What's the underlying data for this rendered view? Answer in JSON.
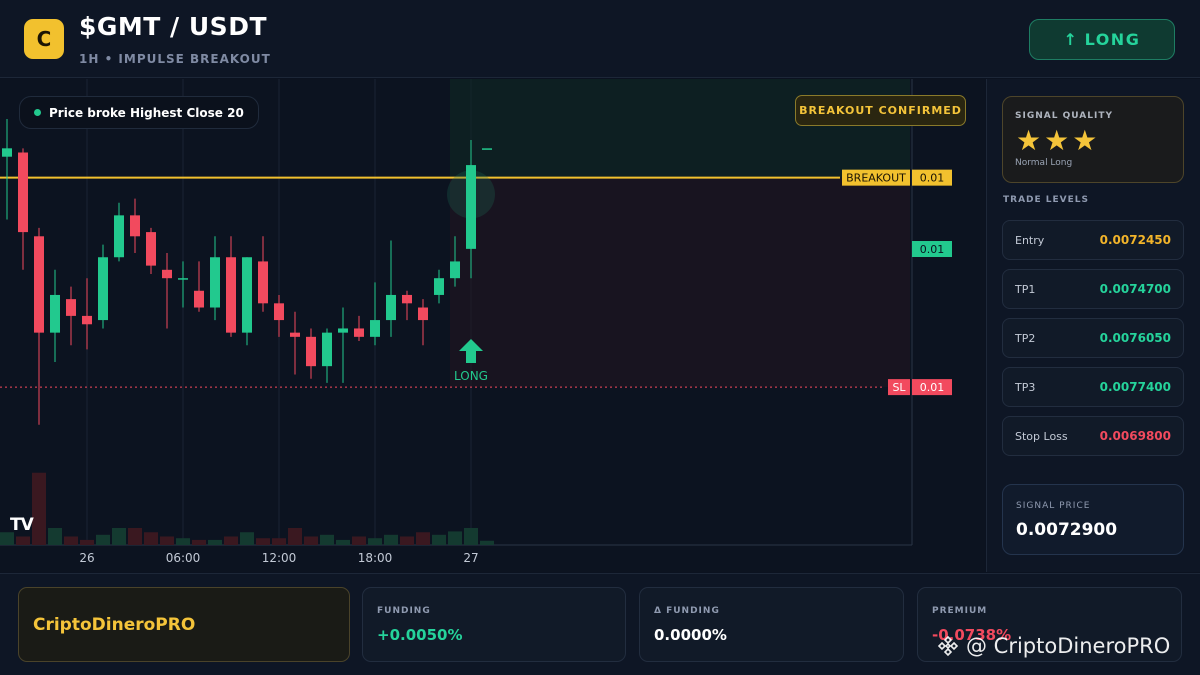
{
  "header": {
    "logo_letter": "C",
    "pair": "$GMT / USDT",
    "subtitle": "1H • IMPULSE BREAKOUT",
    "signal_label": "LONG"
  },
  "chart": {
    "status_pill": "Price broke Highest Close 20",
    "confirmed_badge": "BREAKOUT CONFIRMED",
    "long_marker": "LONG",
    "breakout_tag": "BREAKOUT",
    "sl_tag": "SL",
    "price_tags": [
      "0.01",
      "0.01",
      "0.01"
    ],
    "x_ticks": [
      "26",
      "06:00",
      "12:00",
      "18:00",
      "27"
    ],
    "tv_logo": "TV"
  },
  "panel": {
    "quality_label": "SIGNAL QUALITY",
    "quality_stars": "★★★",
    "quality_type": "Normal Long",
    "levels_title": "TRADE LEVELS",
    "levels": [
      {
        "name": "Entry",
        "value": "0.0072450",
        "color": "#f2b42a"
      },
      {
        "name": "TP1",
        "value": "0.0074700",
        "color": "#25d39b"
      },
      {
        "name": "TP2",
        "value": "0.0076050",
        "color": "#25d39b"
      },
      {
        "name": "TP3",
        "value": "0.0077400",
        "color": "#25d39b"
      },
      {
        "name": "Stop Loss",
        "value": "0.0069800",
        "color": "#f24a5e"
      }
    ],
    "signal_price_label": "SIGNAL PRICE",
    "signal_price": "0.0072900"
  },
  "footer": {
    "brand": "CriptoDineroPRO",
    "funding_label": "FUNDING",
    "funding_value": "+0.0050%",
    "dfunding_label": "Δ FUNDING",
    "dfunding_value": "0.0000%",
    "premium_label": "PREMIUM",
    "premium_value": "-0.0738%",
    "watermark": "@ CriptoDineroPRO"
  },
  "colors": {
    "up": "#22c98e",
    "down": "#f24a5e",
    "breakout": "#f2c12e"
  },
  "chart_data": {
    "type": "candlestick",
    "candles": [
      {
        "o": 0.007255,
        "h": 0.0073,
        "l": 0.00718,
        "c": 0.007265
      },
      {
        "o": 0.00726,
        "h": 0.007265,
        "l": 0.00712,
        "c": 0.007165
      },
      {
        "o": 0.00716,
        "h": 0.00717,
        "l": 0.006935,
        "c": 0.007045
      },
      {
        "o": 0.007045,
        "h": 0.00712,
        "l": 0.00701,
        "c": 0.00709
      },
      {
        "o": 0.007085,
        "h": 0.0071,
        "l": 0.00703,
        "c": 0.007065
      },
      {
        "o": 0.007065,
        "h": 0.00711,
        "l": 0.007025,
        "c": 0.007055
      },
      {
        "o": 0.00706,
        "h": 0.00715,
        "l": 0.00705,
        "c": 0.007135
      },
      {
        "o": 0.007135,
        "h": 0.0072,
        "l": 0.00713,
        "c": 0.007185
      },
      {
        "o": 0.007185,
        "h": 0.007205,
        "l": 0.00714,
        "c": 0.00716
      },
      {
        "o": 0.007165,
        "h": 0.00717,
        "l": 0.007115,
        "c": 0.007125
      },
      {
        "o": 0.00712,
        "h": 0.00714,
        "l": 0.00705,
        "c": 0.00711
      },
      {
        "o": 0.00711,
        "h": 0.00713,
        "l": 0.007075,
        "c": 0.00711
      },
      {
        "o": 0.007095,
        "h": 0.00713,
        "l": 0.00707,
        "c": 0.007075
      },
      {
        "o": 0.007075,
        "h": 0.00716,
        "l": 0.00706,
        "c": 0.007135
      },
      {
        "o": 0.007135,
        "h": 0.00716,
        "l": 0.00704,
        "c": 0.007045
      },
      {
        "o": 0.007045,
        "h": 0.007135,
        "l": 0.00703,
        "c": 0.007135
      },
      {
        "o": 0.00713,
        "h": 0.00716,
        "l": 0.00707,
        "c": 0.00708
      },
      {
        "o": 0.00708,
        "h": 0.00709,
        "l": 0.00704,
        "c": 0.00706
      },
      {
        "o": 0.007045,
        "h": 0.00707,
        "l": 0.006995,
        "c": 0.00704
      },
      {
        "o": 0.00704,
        "h": 0.00705,
        "l": 0.00699,
        "c": 0.007005
      },
      {
        "o": 0.007005,
        "h": 0.00705,
        "l": 0.006985,
        "c": 0.007045
      },
      {
        "o": 0.007045,
        "h": 0.007075,
        "l": 0.006985,
        "c": 0.00705
      },
      {
        "o": 0.00705,
        "h": 0.007065,
        "l": 0.007035,
        "c": 0.00704
      },
      {
        "o": 0.00704,
        "h": 0.007105,
        "l": 0.00703,
        "c": 0.00706
      },
      {
        "o": 0.00706,
        "h": 0.007155,
        "l": 0.00704,
        "c": 0.00709
      },
      {
        "o": 0.00709,
        "h": 0.007095,
        "l": 0.00706,
        "c": 0.00708
      },
      {
        "o": 0.007075,
        "h": 0.007085,
        "l": 0.00703,
        "c": 0.00706
      },
      {
        "o": 0.00709,
        "h": 0.00712,
        "l": 0.00708,
        "c": 0.00711
      },
      {
        "o": 0.00711,
        "h": 0.00716,
        "l": 0.0071,
        "c": 0.00713
      },
      {
        "o": 0.007145,
        "h": 0.007275,
        "l": 0.00711,
        "c": 0.007245
      },
      {
        "o": 0.007265,
        "h": 0.007265,
        "l": 0.007265,
        "c": 0.007265
      }
    ],
    "volumes": [
      0.15,
      0.1,
      0.85,
      0.2,
      0.1,
      0.06,
      0.12,
      0.2,
      0.2,
      0.15,
      0.1,
      0.08,
      0.06,
      0.06,
      0.1,
      0.15,
      0.08,
      0.08,
      0.2,
      0.1,
      0.12,
      0.06,
      0.1,
      0.08,
      0.12,
      0.1,
      0.15,
      0.12,
      0.16,
      0.2,
      0.05
    ],
    "levels": {
      "breakout": 0.00723,
      "sl": 0.00698
    },
    "ylim": [
      0.00693,
      0.0073
    ]
  }
}
